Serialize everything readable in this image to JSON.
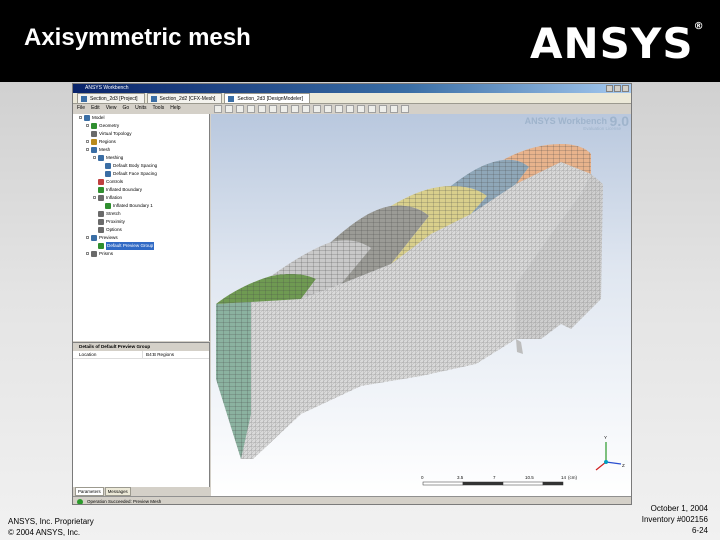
{
  "slide": {
    "title": "Axisymmetric mesh",
    "logo": "ANSYS",
    "logo_reg": "®"
  },
  "window": {
    "title": "ANSYS Workbench",
    "tabs": [
      {
        "label": "Section_2d3 [Project]",
        "active": false
      },
      {
        "label": "Section_2d2 [CFX-Mesh]",
        "active": false
      },
      {
        "label": "Section_2d3 [DesignModeler]",
        "active": true
      }
    ],
    "menu": [
      "File",
      "Edit",
      "View",
      "Go",
      "Units",
      "Tools",
      "Help"
    ]
  },
  "tree": {
    "items": [
      {
        "label": "Model",
        "indent": 0,
        "icon_color": "#3a6ea5"
      },
      {
        "label": "Geometry",
        "indent": 1,
        "icon_color": "#2f8f2f"
      },
      {
        "label": "Virtual Topology",
        "indent": 1,
        "icon_color": "#6a6a6a"
      },
      {
        "label": "Regions",
        "indent": 1,
        "icon_color": "#b88a1c"
      },
      {
        "label": "Mesh",
        "indent": 1,
        "icon_color": "#3a6ea5"
      },
      {
        "label": "Meshing",
        "indent": 2,
        "icon_color": "#3a6ea5"
      },
      {
        "label": "Default Body Spacing",
        "indent": 3,
        "icon_color": "#3a6ea5"
      },
      {
        "label": "Default Face Spacing",
        "indent": 3,
        "icon_color": "#3a6ea5"
      },
      {
        "label": "Controls",
        "indent": 2,
        "icon_color": "#c04040"
      },
      {
        "label": "Inflated Boundary",
        "indent": 2,
        "icon_color": "#2f8f2f"
      },
      {
        "label": "Inflation",
        "indent": 2,
        "icon_color": "#6a6a6a"
      },
      {
        "label": "Inflated Boundary 1",
        "indent": 3,
        "icon_color": "#2f8f2f"
      },
      {
        "label": "Stretch",
        "indent": 2,
        "icon_color": "#6a6a6a"
      },
      {
        "label": "Proximity",
        "indent": 2,
        "icon_color": "#6a6a6a"
      },
      {
        "label": "Options",
        "indent": 2,
        "icon_color": "#6a6a6a"
      },
      {
        "label": "Previews",
        "indent": 1,
        "icon_color": "#3a6ea5"
      },
      {
        "label": "Default Preview Group",
        "indent": 2,
        "icon_color": "#2f8f2f",
        "selected": true
      },
      {
        "label": "Prisms",
        "indent": 1,
        "icon_color": "#6a6a6a"
      }
    ]
  },
  "details": {
    "title": "Details of Default Preview Group",
    "rows": [
      {
        "key": "Location",
        "value": "B4:B Regions"
      }
    ]
  },
  "panel_tabs": [
    {
      "label": "Parameters",
      "active": true
    },
    {
      "label": "Messages",
      "active": false
    }
  ],
  "status": {
    "text": "Operation Succeeded: Preview Mesh"
  },
  "viewport": {
    "brand": "ANSYS Workbench",
    "version": "9.0",
    "subtitle": "Evaluation License",
    "ruler": {
      "ticks": [
        "0",
        "3.5",
        "7",
        "10.5",
        "14"
      ],
      "unit": "(cm)"
    },
    "axes": {
      "y": "Y",
      "z": "Z"
    }
  },
  "footer": {
    "proprietary": "ANSYS, Inc. Proprietary",
    "copyright": "© 2004 ANSYS, Inc.",
    "date": "October 1, 2004",
    "inventory": "Inventory #002156",
    "page": "6-24"
  },
  "colors": {
    "header_bg": "#000000",
    "mesh_orange": "#e8b38c",
    "mesh_blue": "#8fa7b8",
    "mesh_yellow": "#d9cf8c",
    "mesh_grey": "#9b9b96",
    "mesh_green": "#6f9a52",
    "mesh_teal": "#8bb2a0",
    "mesh_body": "#d8d8d8"
  }
}
